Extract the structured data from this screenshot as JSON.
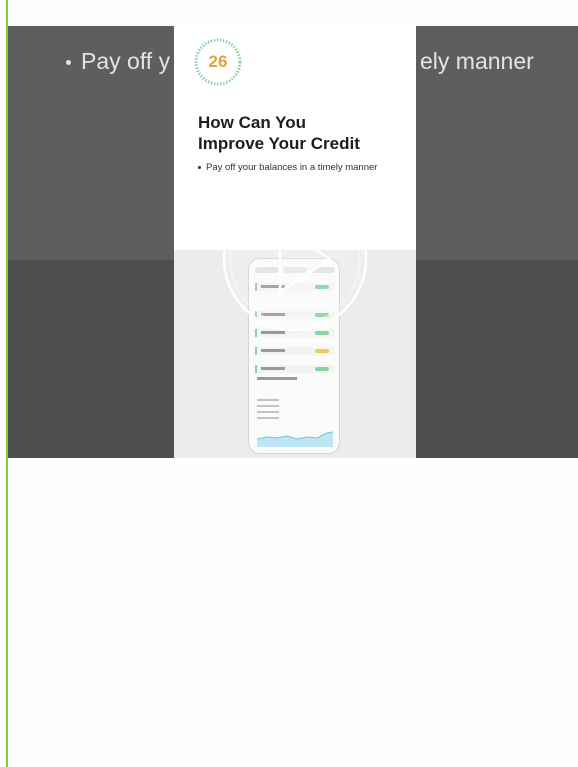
{
  "background_text": {
    "left": "Pay off y",
    "right": "ely manner"
  },
  "card": {
    "score": "26",
    "title_line1": "How Can You",
    "title_line2": "Improve Your Credit",
    "bullet": "Pay off your balances in a timely manner"
  },
  "colors": {
    "accent_green": "#8cc63f",
    "score_orange": "#e2a23b",
    "ring_green": "#8fd0a8"
  },
  "icons": {
    "play": "play-icon",
    "score_ring": "progress-ring-icon"
  }
}
